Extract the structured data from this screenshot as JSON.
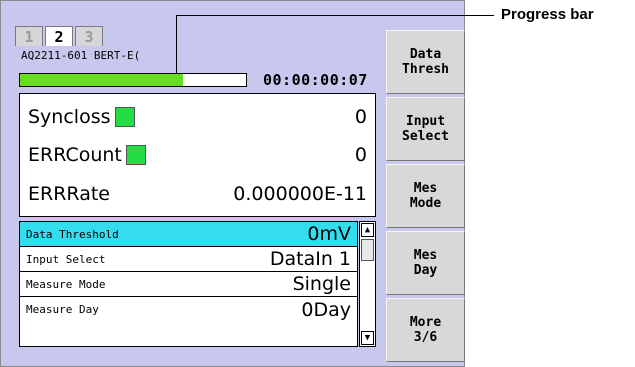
{
  "tabs": [
    {
      "label": "1",
      "active": false
    },
    {
      "label": "2",
      "active": true
    },
    {
      "label": "3",
      "active": false
    }
  ],
  "device_name": "AQ2211-601 BERT-E(",
  "progress": {
    "fraction": 0.72,
    "elapsed": "00:00:00:07",
    "fill_color": "#66dd22"
  },
  "status": {
    "syncloss": {
      "label": "Syncloss",
      "value": "0",
      "led_color": "#22dd44"
    },
    "errcount": {
      "label": "ERRCount",
      "value": "0",
      "led_color": "#22dd44"
    },
    "errrate": {
      "label": "ERRRate",
      "value": "0.000000E-11"
    }
  },
  "settings": [
    {
      "label": "Data Threshold",
      "value": "0mV",
      "selected": true
    },
    {
      "label": "Input Select",
      "value": "DataIn 1",
      "selected": false
    },
    {
      "label": "Measure Mode",
      "value": "Single",
      "selected": false
    },
    {
      "label": "Measure Day",
      "value": "0Day",
      "selected": false
    }
  ],
  "softkeys": [
    {
      "label": "Data\nThresh"
    },
    {
      "label": "Input\nSelect"
    },
    {
      "label": "Mes\nMode"
    },
    {
      "label": "Mes\nDay"
    },
    {
      "label": "More\n3/6"
    }
  ],
  "callout": {
    "label": "Progress bar"
  },
  "colors": {
    "screen_bg": "#c8c8ee",
    "selected_row": "#33ddee",
    "led": "#22dd44"
  }
}
